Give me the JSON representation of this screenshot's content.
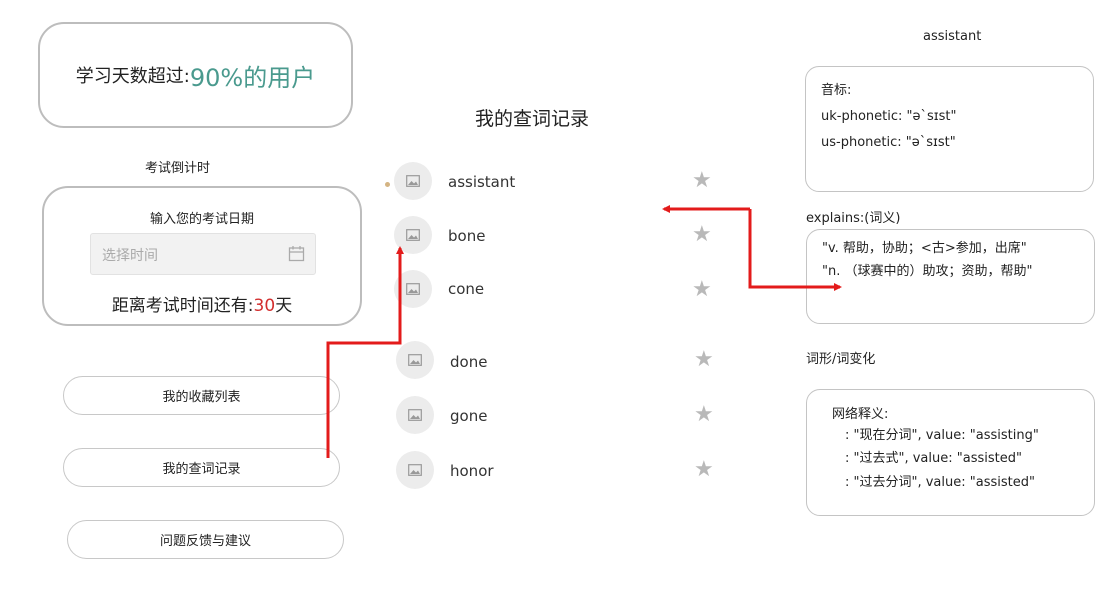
{
  "study_card": {
    "prefix": "学习天数超过:",
    "highlight": "90%的用户"
  },
  "countdown": {
    "title": "考试倒计时",
    "prompt": "输入您的考试日期",
    "date_placeholder": "选择时间",
    "remaining_prefix": "距离考试时间还有:",
    "remaining_days": "30",
    "remaining_suffix": "天"
  },
  "menu": {
    "favorites": "我的收藏列表",
    "history": "我的查词记录",
    "feedback": "问题反馈与建议"
  },
  "history_list": {
    "title": "我的查词记录",
    "words": [
      "assistant",
      "bone",
      "cone",
      "done",
      "gone",
      "honor"
    ]
  },
  "detail": {
    "word": "assistant",
    "phonetic_title": "音标:",
    "uk_phonetic": "uk-phonetic: \"ə`sɪst\"",
    "us_phonetic": "us-phonetic: \"ə`sɪst\"",
    "explains_title": "explains:(词义)",
    "explains": [
      "\"v. 帮助，协助；<古>参加，出席\"",
      "\"n. （球赛中的）助攻；资助，帮助\""
    ],
    "forms_title": "词形/词变化",
    "web_title": "网络释义:",
    "web_items": [
      ": \"现在分词\", value: \"assisting\"",
      ": \"过去式\", value: \"assisted\"",
      ": \"过去分词\", value: \"assisted\""
    ]
  },
  "colors": {
    "accent_teal": "#4a9a8e",
    "countdown_red": "#d32f2f",
    "arrow_red": "#e31b1b"
  }
}
